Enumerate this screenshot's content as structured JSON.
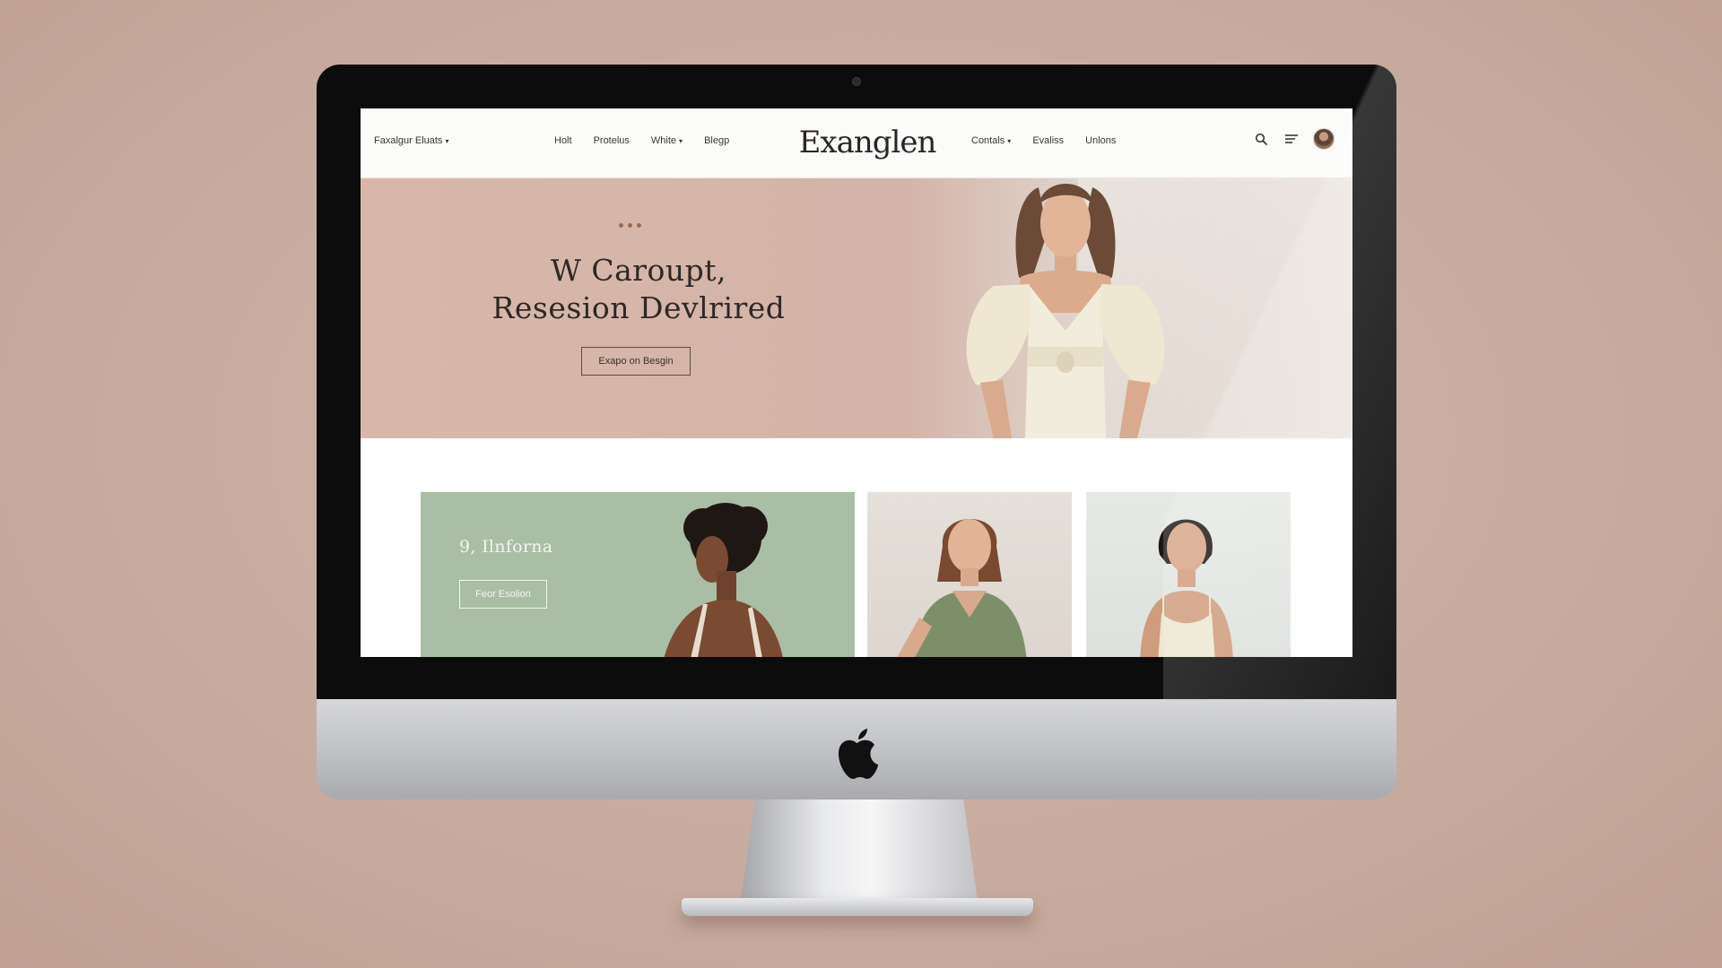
{
  "navbar": {
    "left_menu": "Faxalgur Eluats",
    "links_left": [
      "Holt",
      "Protelus",
      "White",
      "Blegp"
    ],
    "brand": "Exanglen",
    "links_right": [
      "Contals",
      "Evaliss",
      "Unlons"
    ],
    "icons": [
      "search-icon",
      "menu-icon",
      "avatar"
    ]
  },
  "hero": {
    "title_line1": "W Caroupt,",
    "title_line2": "Resesion Devlrired",
    "button_label": "Exapo on Besgin",
    "dots": 3
  },
  "feature_card": {
    "title": "9, Ilnforna",
    "button_label": "Feor Esolion"
  },
  "colors": {
    "hero_bg": "#d8b7aa",
    "feature_bg": "#a9bea4",
    "page_bg": "#c8ab9f",
    "bezel": "#0c0c0d"
  }
}
